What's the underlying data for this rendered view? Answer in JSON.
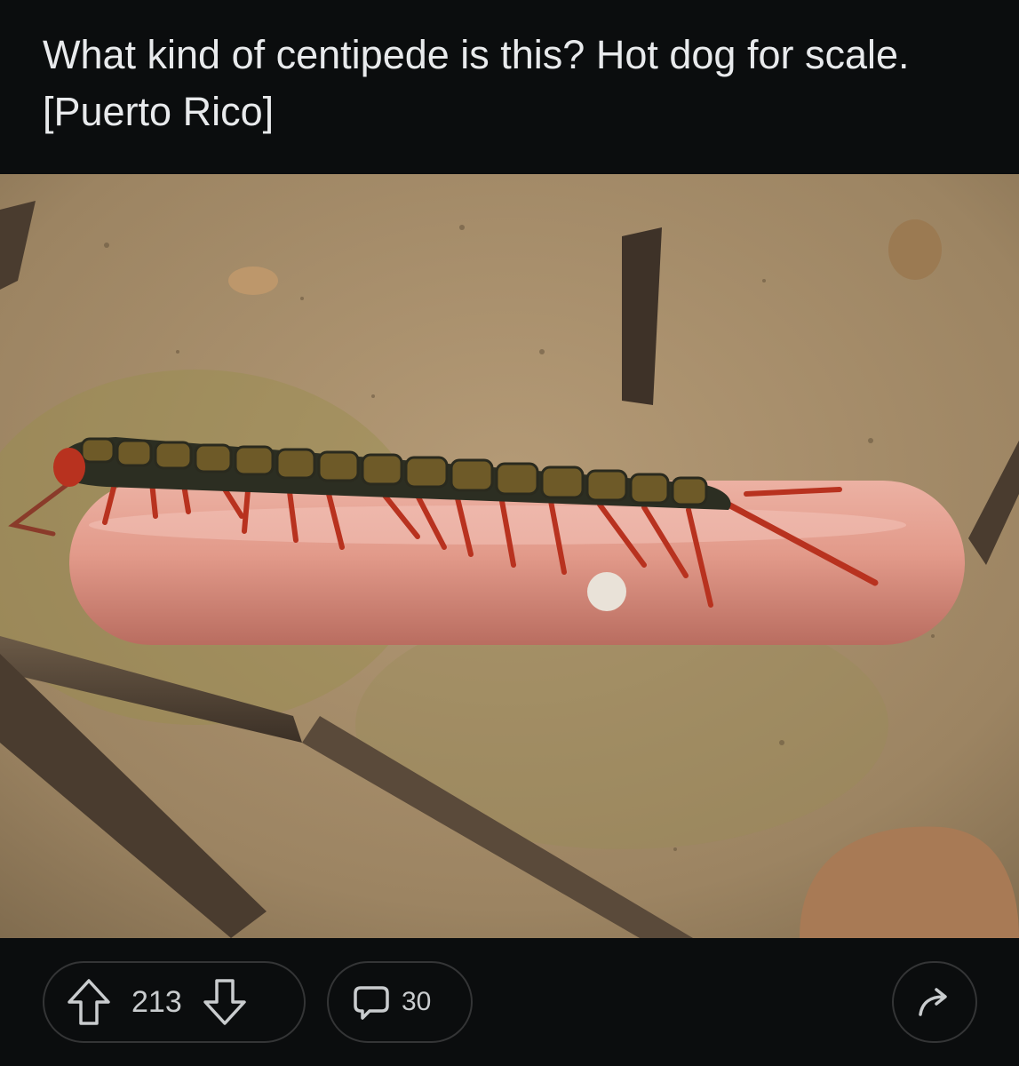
{
  "post": {
    "title": "What kind of centipede is this? Hot dog for scale. [Puerto Rico]",
    "image_description_name": "centipede-on-hot-dog-photo"
  },
  "actions": {
    "upvote_icon": "arrow-up-icon",
    "downvote_icon": "arrow-down-icon",
    "vote_count": "213",
    "comment_icon": "speech-bubble-icon",
    "comment_count": "30",
    "share_icon": "share-arrow-icon"
  },
  "colors": {
    "background": "#0b0d0e",
    "text": "#e8eaec",
    "pill_border": "#343536"
  }
}
